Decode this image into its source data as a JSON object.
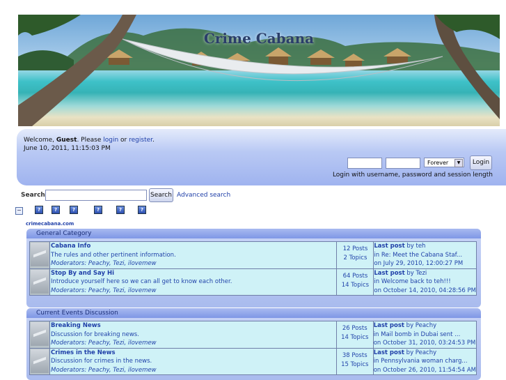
{
  "site": {
    "title": "Crime Cabana"
  },
  "user": {
    "welcome_prefix": "Welcome, ",
    "guest": "Guest",
    "please": ". Please ",
    "login_link": "login",
    "or": " or ",
    "register_link": "register",
    "dot": ".",
    "datetime": "June 10, 2011, 11:15:03 PM"
  },
  "login": {
    "username_value": "",
    "password_value": "",
    "duration_selected": "Forever",
    "button": "Login",
    "note": "Login with username, password and session length"
  },
  "search": {
    "label": "Search:",
    "value": "",
    "button": "Search",
    "advanced": "Advanced search"
  },
  "forum_domain": "crimecabana.com",
  "categories": [
    {
      "title": "General Category",
      "boards": [
        {
          "name": "Cabana Info",
          "description": "The rules and other pertinent information.",
          "moderators": "Moderators: Peachy, Tezi, ilovemew",
          "posts": "12 Posts",
          "topics": "2 Topics",
          "last_label": "Last post",
          "last_by": " by teh",
          "last_in": "in Re: Meet the Cabana Staf...",
          "last_on": "on July 29, 2010, 12:00:27 PM"
        },
        {
          "name": "Stop By and Say Hi",
          "description": "Introduce yourself here so we can all get to know each other.",
          "moderators": "Moderators: Peachy, Tezi, ilovemew",
          "posts": "64 Posts",
          "topics": "14 Topics",
          "last_label": "Last post",
          "last_by": " by Tezi",
          "last_in": "in Welcome back to teh!!!",
          "last_on": "on October 14, 2010, 04:28:56 PM"
        }
      ]
    },
    {
      "title": "Current Events Discussion",
      "boards": [
        {
          "name": "Breaking News",
          "description": "Discussion for breaking news.",
          "moderators": "Moderators: Peachy, Tezi, ilovemew",
          "posts": "26 Posts",
          "topics": "14 Topics",
          "last_label": "Last post",
          "last_by": " by Peachy",
          "last_in": "in Mail bomb in Dubai sent ...",
          "last_on": "on October 31, 2010, 03:24:53 PM"
        },
        {
          "name": "Crimes in the News",
          "description": "Discussion for crimes in the news.",
          "moderators": "Moderators: Peachy, Tezi, ilovemew",
          "posts": "38 Posts",
          "topics": "15 Topics",
          "last_label": "Last post",
          "last_by": " by Peachy",
          "last_in": "in Pennsylvania woman charg...",
          "last_on": "on October 26, 2010, 11:54:54 AM"
        }
      ]
    }
  ],
  "icons": {
    "collapse": "collapse-icon",
    "toolbar": [
      "help-icon",
      "help-icon",
      "help-icon",
      "help-icon",
      "help-icon",
      "help-icon"
    ],
    "board": "board-icon"
  },
  "colors": {
    "link": "#1f3fa8",
    "board_bg": "#cff2f7",
    "category_header": "#8ea4ea"
  }
}
